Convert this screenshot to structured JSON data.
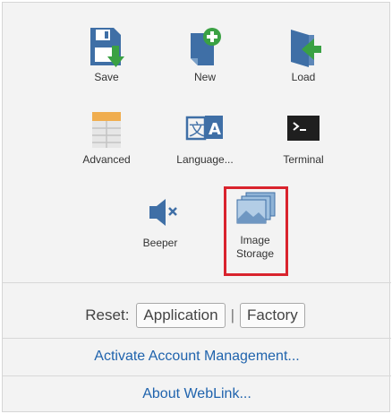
{
  "tiles": {
    "save": {
      "label": "Save"
    },
    "new": {
      "label": "New"
    },
    "load": {
      "label": "Load"
    },
    "advanced": {
      "label": "Advanced"
    },
    "language": {
      "label": "Language..."
    },
    "terminal": {
      "label": "Terminal"
    },
    "beeper": {
      "label": "Beeper"
    },
    "image_storage": {
      "label_line1": "Image",
      "label_line2": "Storage"
    }
  },
  "reset": {
    "label": "Reset:",
    "application_label": "Application",
    "separator": "|",
    "factory_label": "Factory"
  },
  "links": {
    "activate_account": "Activate Account Management...",
    "about": "About WebLink..."
  },
  "colors": {
    "highlight": "#d9232d",
    "link": "#1f63ad",
    "icon_blue": "#3a6ea8",
    "icon_green": "#3aa143"
  }
}
